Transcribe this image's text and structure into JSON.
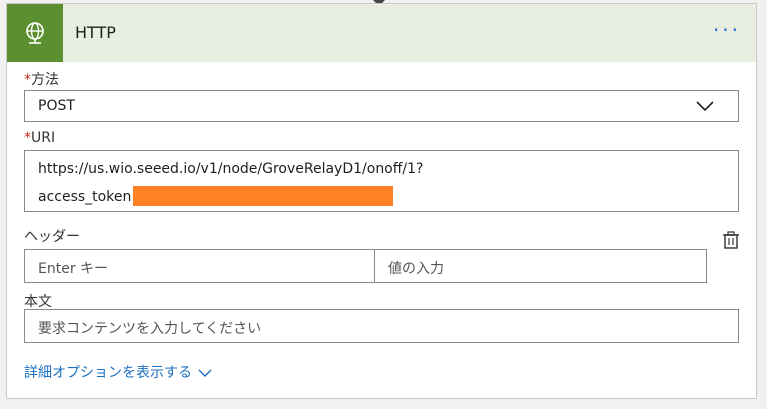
{
  "header": {
    "title": "HTTP",
    "icon": "globe-network-icon",
    "more": "···",
    "accent_color": "#5c8f2f"
  },
  "method": {
    "required_mark": "*",
    "label": "方法",
    "value": "POST"
  },
  "uri": {
    "required_mark": "*",
    "label": "URI",
    "line1": "https://us.wio.seeed.io/v1/node/GroveRelayD1/onoff/1?",
    "line2": "access_token="
  },
  "headers": {
    "label": "ヘッダー",
    "key_placeholder": "Enter キー",
    "value_placeholder": "値の入力"
  },
  "body": {
    "label": "本文",
    "placeholder": "要求コンテンツを入力してください"
  },
  "advanced": {
    "label": "詳細オプションを表示する"
  }
}
